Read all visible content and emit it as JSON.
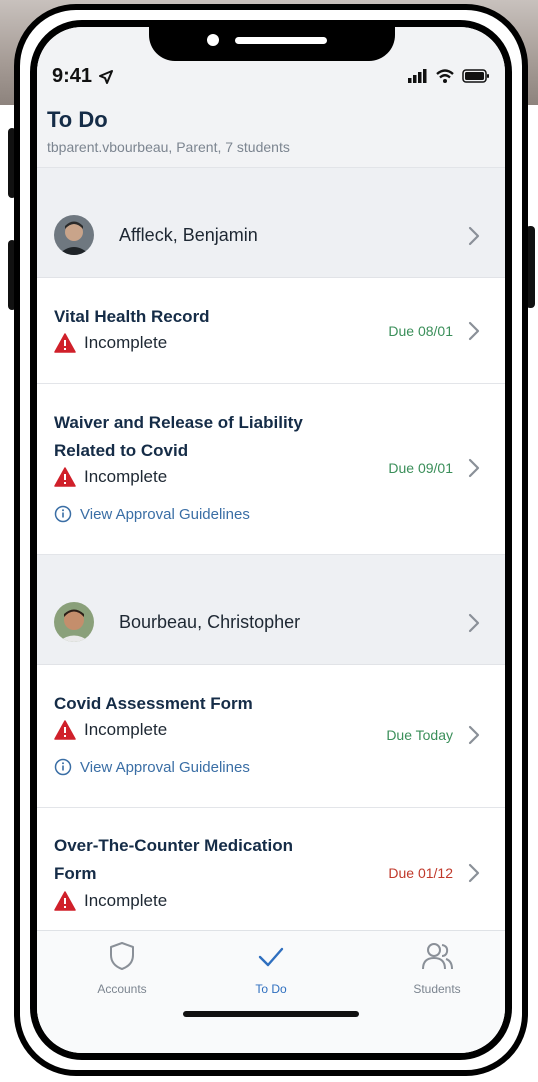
{
  "status_bar": {
    "time": "9:41"
  },
  "header": {
    "title": "To Do",
    "subtitle": "tbparent.vbourbeau, Parent, 7 students"
  },
  "sections": [
    {
      "student": "Affleck, Benjamin",
      "items": [
        {
          "title_lines": [
            "Vital Health Record"
          ],
          "status": "Incomplete",
          "due": "Due 08/01",
          "due_color": "green",
          "guidelines": ""
        },
        {
          "title_lines": [
            "Waiver and Release of Liability",
            "Related to Covid"
          ],
          "status": "Incomplete",
          "due": "Due 09/01",
          "due_color": "green",
          "guidelines": "View Approval Guidelines"
        }
      ]
    },
    {
      "student": "Bourbeau, Christopher",
      "items": [
        {
          "title_lines": [
            "Covid Assessment Form"
          ],
          "status": "Incomplete",
          "due": "Due Today",
          "due_color": "green",
          "guidelines": "View Approval Guidelines"
        },
        {
          "title_lines": [
            "Over-The-Counter Medication",
            "Form"
          ],
          "status": "Incomplete",
          "due": "Due 01/12",
          "due_color": "red",
          "guidelines": ""
        }
      ]
    }
  ],
  "tabs": [
    {
      "label": "Accounts",
      "icon": "shield-icon",
      "active": false
    },
    {
      "label": "To Do",
      "icon": "checkmark-icon",
      "active": true
    },
    {
      "label": "Students",
      "icon": "people-icon",
      "active": false
    }
  ],
  "colors": {
    "title": "#152c47",
    "accent": "#2f6fbf",
    "due_green": "#3b8f5a",
    "due_red": "#c0392b",
    "warning": "#d0202a"
  }
}
